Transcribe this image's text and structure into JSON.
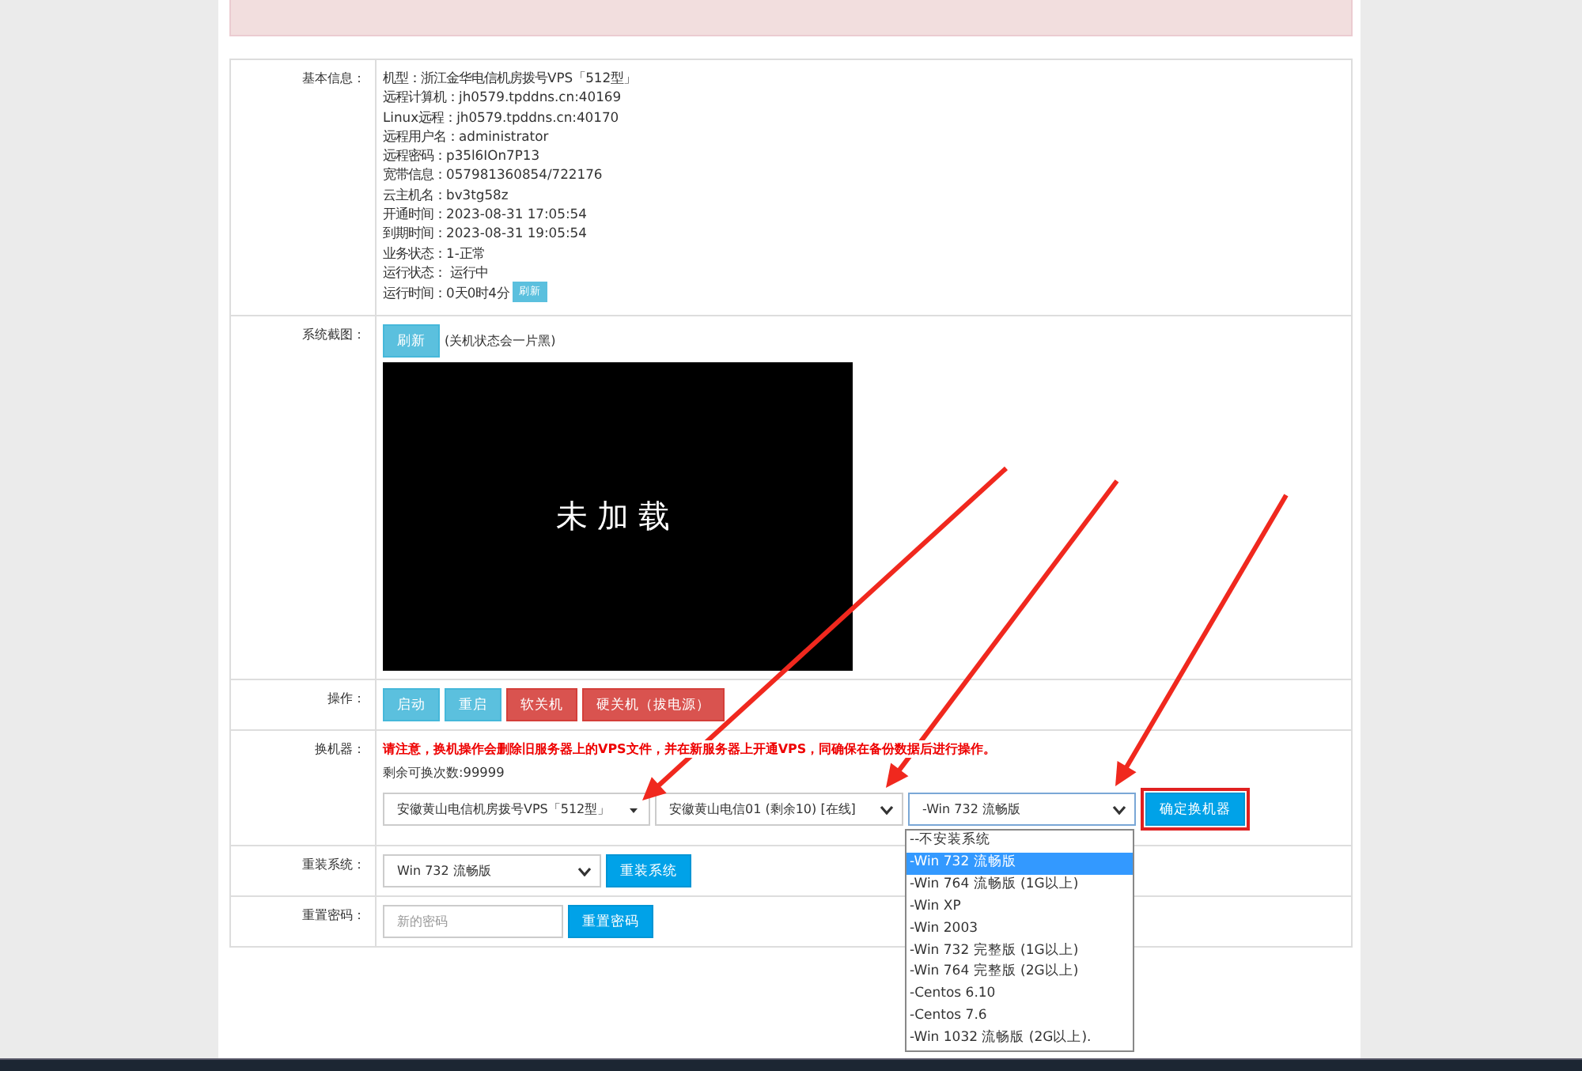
{
  "info": {
    "label": "基本信息：",
    "lines": [
      "机型：浙江金华电信机房拨号VPS「512型」",
      "远程计算机：jh0579.tpddns.cn:40169",
      "Linux远程：jh0579.tpddns.cn:40170",
      "远程用户名：administrator",
      "远程密码：p35l6IOn7P13",
      "宽带信息：057981360854/722176",
      "云主机名：bv3tg58z",
      "开通时间：2023-08-31 17:05:54",
      "到期时间：2023-08-31 19:05:54",
      "业务状态：1-正常",
      "运行状态： 运行中",
      "运行时间：0天0时4分"
    ],
    "refresh": "刷新"
  },
  "screenshot": {
    "label": "系统截图：",
    "refresh": "刷新",
    "note": "(关机状态会一片黑)",
    "screen_text": "未加载"
  },
  "operations": {
    "label": "操作：",
    "buttons": [
      {
        "label": "启动",
        "kind": "info"
      },
      {
        "label": "重启",
        "kind": "info"
      },
      {
        "label": "软关机",
        "kind": "danger"
      },
      {
        "label": "硬关机（拔电源）",
        "kind": "danger"
      }
    ]
  },
  "swap": {
    "label": "换机器：",
    "warning": "请注意，换机操作会删除旧服务器上的VPS文件，并在新服务器上开通VPS，同确保在备份数据后进行操作。",
    "remaining": "剩余可换次数:99999",
    "model_select": "安徽黄山电信机房拨号VPS「512型」",
    "server_select": "安徽黄山电信01 (剩余10) [在线]",
    "os_select": "-Win 732 流畅版",
    "confirm": "确定换机器",
    "os_options": [
      {
        "label": "--不安装系统",
        "selected": false
      },
      {
        "label": "-Win 732 流畅版",
        "selected": true
      },
      {
        "label": "-Win 764 流畅版 (1G以上)",
        "selected": false
      },
      {
        "label": "-Win XP",
        "selected": false
      },
      {
        "label": "-Win 2003",
        "selected": false
      },
      {
        "label": "-Win 732 完整版 (1G以上)",
        "selected": false
      },
      {
        "label": "-Win 764 完整版 (2G以上)",
        "selected": false
      },
      {
        "label": "-Centos 6.10",
        "selected": false
      },
      {
        "label": "-Centos 7.6",
        "selected": false
      },
      {
        "label": "-Win 1032 流畅版 (2G以上).",
        "selected": false
      }
    ]
  },
  "reinstall": {
    "label": "重装系统：",
    "select": "Win 732 流畅版",
    "button": "重装系统"
  },
  "reset_password": {
    "label": "重置密码：",
    "placeholder": "新的密码",
    "button": "重置密码"
  }
}
